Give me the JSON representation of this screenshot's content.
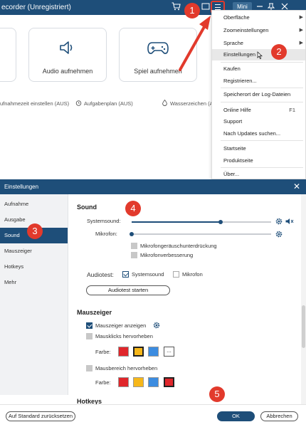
{
  "app": {
    "title": "ecorder (Unregistriert)",
    "mini_label": "Mini",
    "cards": [
      {
        "label": ""
      },
      {
        "label": "Audio aufnehmen"
      },
      {
        "label": "Spiel aufnehmen"
      }
    ],
    "status": {
      "duration": "ufnahmezeit einstellen (AUS)",
      "schedule": "Aufgabenplan (AUS)",
      "watermark": "Wasserzeichen (A"
    },
    "icons": [
      "cart-icon",
      "person-icon",
      "menu-icon",
      "minimize-icon",
      "pin-icon",
      "close-icon"
    ]
  },
  "menu": {
    "items": [
      {
        "label": "Oberfläche",
        "submenu": true
      },
      {
        "label": "Zoomeinstellungen",
        "submenu": true
      },
      {
        "label": "Sprache",
        "submenu": true
      },
      {
        "label": "Einstellungen",
        "highlighted": true
      },
      {
        "label": "Kaufen"
      },
      {
        "label": "Registrieren..."
      },
      {
        "label": "Speicherort der Log-Dateien"
      },
      {
        "label": "Online Hilfe",
        "shortcut": "F1"
      },
      {
        "label": "Support"
      },
      {
        "label": "Nach Updates suchen..."
      },
      {
        "label": "Startseite"
      },
      {
        "label": "Produktseite"
      },
      {
        "label": "Über..."
      }
    ]
  },
  "callouts": [
    "1",
    "2",
    "3",
    "4",
    "5"
  ],
  "dialog": {
    "title": "Einstellungen",
    "sidebar": [
      "Aufnahme",
      "Ausgabe",
      "Sound",
      "Mauszeiger",
      "Hotkeys",
      "Mehr"
    ],
    "active_sidebar": "Sound",
    "sound": {
      "title": "Sound",
      "system_label": "Systemsound:",
      "system_level": 0.64,
      "mic_label": "Mikrofon:",
      "mic_level": 0.0,
      "noise_label": "Mikrofongeräuschunterdrückung",
      "enhance_label": "Mikrofonverbesserung",
      "audiotest_label": "Audiotest:",
      "test_system_label": "Systemsound",
      "test_mic_label": "Mikrofon",
      "test_button": "Audiotest starten"
    },
    "mouse": {
      "title": "Mauszeiger",
      "show_cursor": "Mauszeiger anzeigen",
      "highlight_clicks": "Mausklicks hervorheben",
      "color_label": "Farbe:",
      "highlight_area": "Mausbereich hervorheben",
      "colors_1": [
        "#e0262b",
        "#f6b71a",
        "#3c8ce0"
      ],
      "colors_2": [
        "#e0262b",
        "#f6b71a",
        "#3c8ce0",
        "#e0262b"
      ],
      "more_label": "..."
    },
    "next_section": "Hotkeys",
    "reset_button": "Auf Standard zurücksetzen",
    "ok_button": "OK",
    "cancel_button": "Abbrechen"
  },
  "colors": {
    "accent": "#1e4e79",
    "callout": "#e23a2c"
  }
}
